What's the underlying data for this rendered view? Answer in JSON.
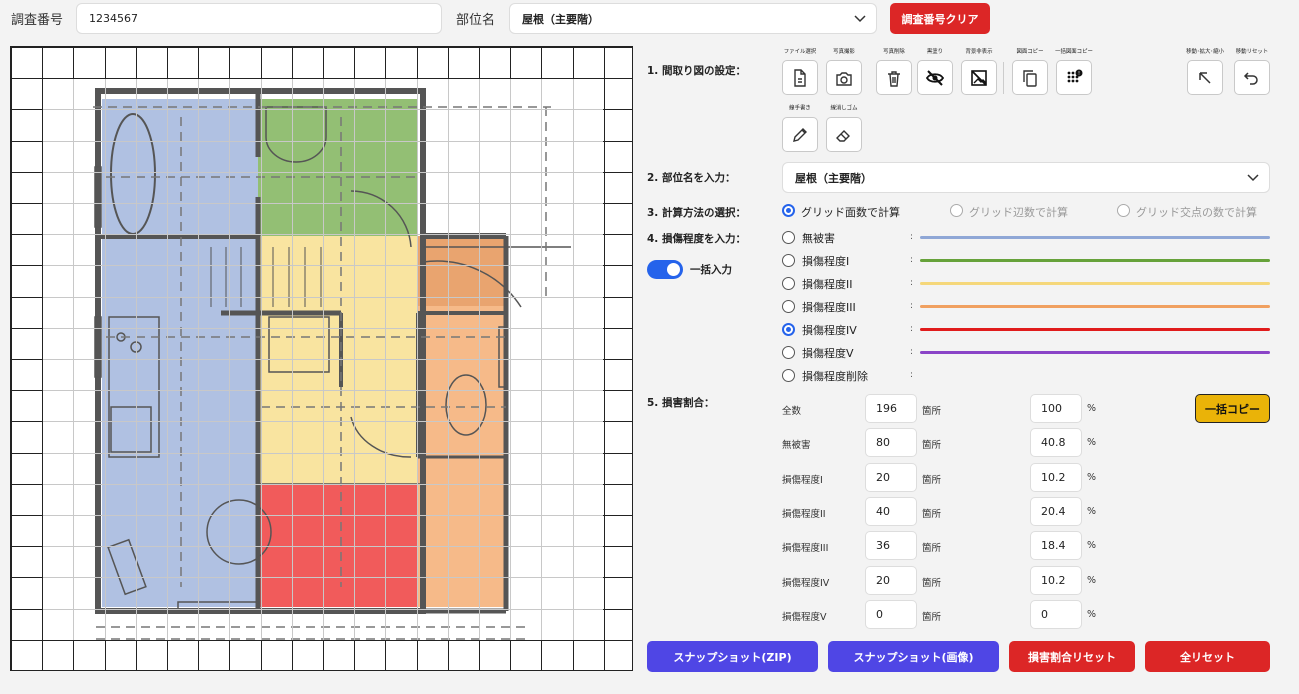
{
  "header": {
    "survey_label": "調査番号",
    "survey_value": "1234567",
    "part_label": "部位名",
    "part_value": "屋根（主要階）",
    "clear_button": "調査番号クリア"
  },
  "steps": {
    "s1": "1. 間取り図の設定：",
    "s2": "2. 部位名を入力：",
    "s3": "3. 計算方法の選択：",
    "s4": "4. 損傷程度を入力：",
    "s5": "5. 損害割合："
  },
  "toolbar": [
    {
      "label": "ファイル選択",
      "icon": "file-icon"
    },
    {
      "label": "写真撮影",
      "icon": "camera-icon"
    },
    {
      "label": "写真削除",
      "icon": "trash-icon"
    },
    {
      "label": "黒塗り",
      "icon": "eye-off-icon"
    },
    {
      "label": "背景非表示",
      "icon": "image-off-icon"
    },
    {
      "label": "図面コピー",
      "icon": "copy-icon"
    },
    {
      "label": "一括図面コピー",
      "icon": "grid-copy-icon"
    },
    {
      "label": "移動･拡大･縮小",
      "icon": "arrow-up-left-icon"
    },
    {
      "label": "移動リセット",
      "icon": "undo-icon"
    },
    {
      "label": "線手書き",
      "icon": "pencil-icon"
    },
    {
      "label": "線消しゴム",
      "icon": "eraser-icon"
    }
  ],
  "part_select": "屋根（主要階）",
  "calc_methods": [
    {
      "label": "グリッド面数で計算",
      "selected": true,
      "enabled": true
    },
    {
      "label": "グリッド辺数で計算",
      "selected": false,
      "enabled": false
    },
    {
      "label": "グリッド交点の数で計算",
      "selected": false,
      "enabled": false
    }
  ],
  "bulk_toggle": {
    "label": "一括入力",
    "on": true
  },
  "damage_levels": [
    {
      "label": "無被害",
      "color": "#8fa7d6",
      "selected": false
    },
    {
      "label": "損傷程度I",
      "color": "#66a23a",
      "selected": false
    },
    {
      "label": "損傷程度II",
      "color": "#f5d77a",
      "selected": false
    },
    {
      "label": "損傷程度III",
      "color": "#f0a060",
      "selected": false
    },
    {
      "label": "損傷程度IV",
      "color": "#e01b1b",
      "selected": true
    },
    {
      "label": "損傷程度V",
      "color": "#8a44c7",
      "selected": false
    },
    {
      "label": "損傷程度削除",
      "color": "",
      "selected": false
    }
  ],
  "colon": ":",
  "ratio_rows": [
    {
      "label": "全数",
      "count": "196",
      "unit": "箇所",
      "pct": "100",
      "pct_unit": "%"
    },
    {
      "label": "無被害",
      "count": "80",
      "unit": "箇所",
      "pct": "40.8",
      "pct_unit": "%"
    },
    {
      "label": "損傷程度I",
      "count": "20",
      "unit": "箇所",
      "pct": "10.2",
      "pct_unit": "%"
    },
    {
      "label": "損傷程度II",
      "count": "40",
      "unit": "箇所",
      "pct": "20.4",
      "pct_unit": "%"
    },
    {
      "label": "損傷程度III",
      "count": "36",
      "unit": "箇所",
      "pct": "18.4",
      "pct_unit": "%"
    },
    {
      "label": "損傷程度IV",
      "count": "20",
      "unit": "箇所",
      "pct": "10.2",
      "pct_unit": "%"
    },
    {
      "label": "損傷程度V",
      "count": "0",
      "unit": "箇所",
      "pct": "0",
      "pct_unit": "%"
    }
  ],
  "bulk_copy_button": "一括コピー",
  "bottom_buttons": {
    "snapshot_zip": "スナップショット(ZIP)",
    "snapshot_img": "スナップショット(画像)",
    "reset_ratio": "損害割合リセット",
    "reset_all": "全リセット"
  }
}
